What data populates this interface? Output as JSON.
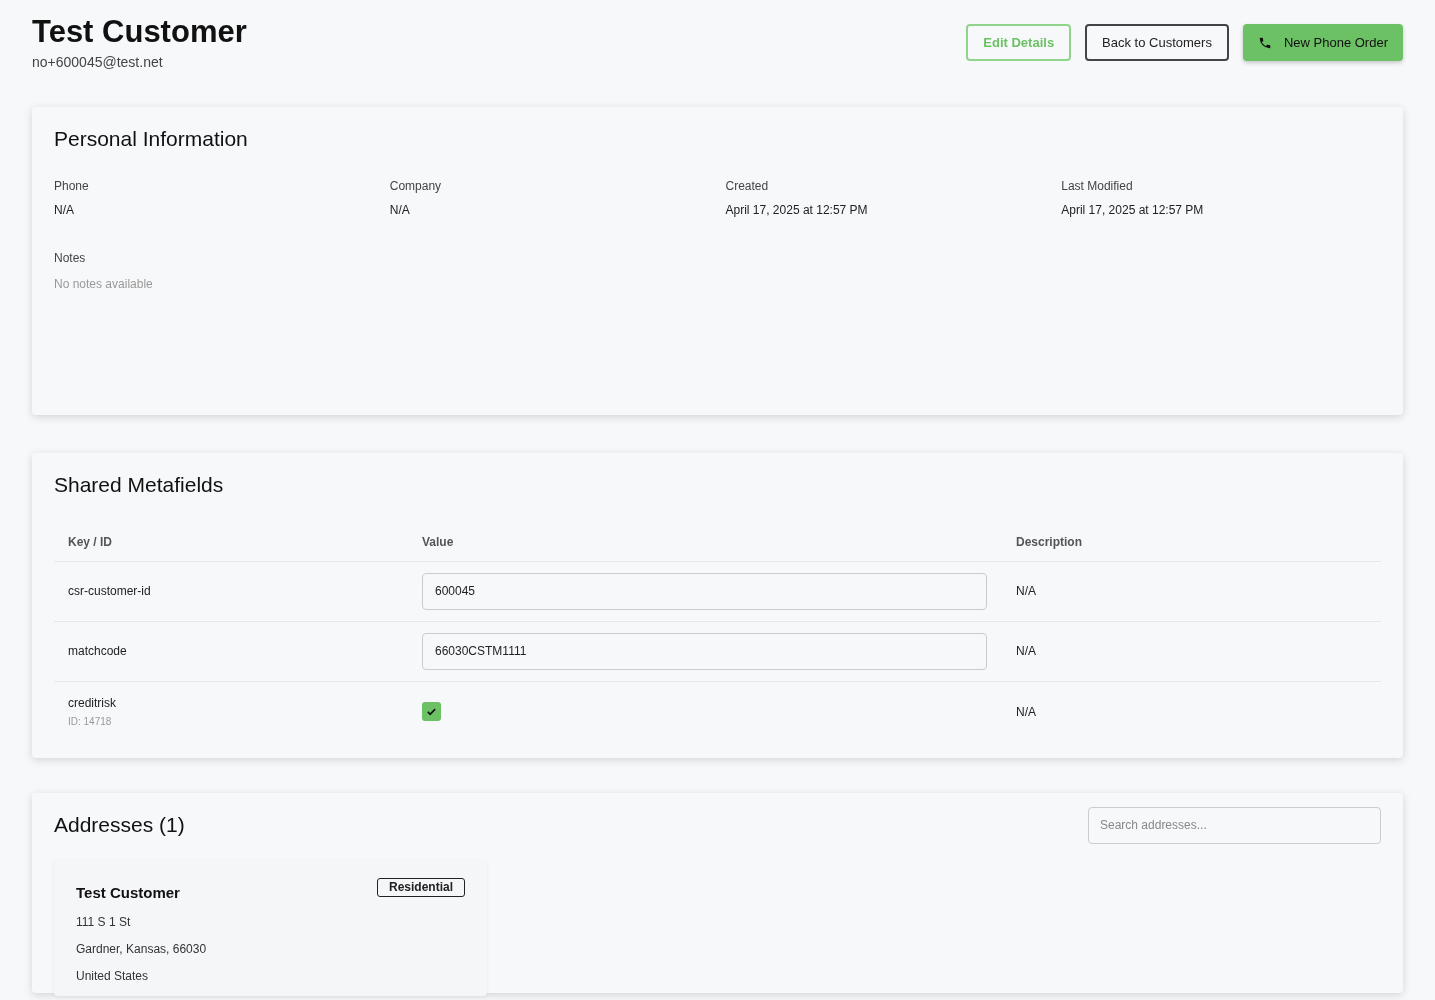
{
  "header": {
    "title": "Test Customer",
    "email": "no+600045@test.net"
  },
  "actions": [
    {
      "label": "Edit Details",
      "kind": "outline-green"
    },
    {
      "label": "Back to Customers",
      "kind": "outline"
    },
    {
      "label": "New Phone Order",
      "kind": "primary"
    }
  ],
  "personal_information": {
    "title": "Personal Information",
    "fields": [
      {
        "label": "Phone",
        "value": "N/A"
      },
      {
        "label": "Company",
        "value": "N/A"
      },
      {
        "label": "Created",
        "value": "April 17, 2025 at 12:57 PM"
      },
      {
        "label": "Last Modified",
        "value": "April 17, 2025 at 12:57 PM"
      }
    ],
    "notes": {
      "label": "Notes",
      "value": "No notes available"
    }
  },
  "shared_metafields": {
    "title": "Shared Metafields",
    "columns": [
      "Key / ID",
      "Value",
      "Description"
    ],
    "rows": [
      {
        "key": "csr-customer-id",
        "kind": "input",
        "value": "600045",
        "description": "N/A"
      },
      {
        "key": "matchcode",
        "kind": "input",
        "value": "66030CSTM1111",
        "description": "N/A"
      },
      {
        "key": "creditrisk",
        "id": "ID: 14718",
        "kind": "checkbox",
        "checked": true,
        "description": "N/A"
      }
    ]
  },
  "addresses": {
    "title": "Addresses (1)",
    "search": {
      "placeholder": "Search addresses..."
    },
    "items": [
      {
        "name": "Test Customer",
        "tag": "Residential",
        "lines": [
          "111 S 1 St",
          "Gardner, Kansas, 66030",
          "United States"
        ]
      }
    ]
  }
}
